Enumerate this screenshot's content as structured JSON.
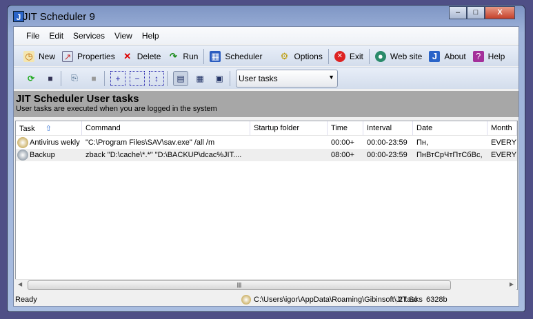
{
  "window": {
    "title": "JIT Scheduler 9",
    "minimize": "–",
    "maximize": "□",
    "close": "X"
  },
  "menu": [
    "File",
    "Edit",
    "Services",
    "View",
    "Help"
  ],
  "toolbar": {
    "new": "New",
    "properties": "Properties",
    "delete": "Delete",
    "run": "Run",
    "scheduler": "Scheduler",
    "options": "Options",
    "exit": "Exit",
    "website": "Web site",
    "about": "About",
    "help": "Help"
  },
  "view_select": {
    "value": "User tasks"
  },
  "panel": {
    "title": "JIT Scheduler User tasks",
    "subtitle": "User tasks are executed when you are logged in the system"
  },
  "columns": [
    "Task",
    "Command",
    "Startup folder",
    "Time",
    "Interval",
    "Date",
    "Month"
  ],
  "rows": [
    {
      "task": "Antivirus wekly",
      "command": "\"C:\\Program Files\\SAV\\sav.exe\" /all /m",
      "folder": "",
      "time": "00:00+",
      "interval": "00:00-23:59",
      "date": "Пн,",
      "month": "EVERY"
    },
    {
      "task": "Backup",
      "command": "zback \"D:\\cache\\*.*\" \"D:\\BACKUP\\dcac%JIT....",
      "folder": "",
      "time": "08:00+",
      "interval": "00:00-23:59",
      "date": "ПнВтСрЧтПтСбВс,",
      "month": "EVERY"
    }
  ],
  "status": {
    "text": "Ready",
    "path": "C:\\Users\\igor\\AppData\\Roaming\\Gibinsoft\\JIT Sc",
    "tasks": "2 tasks",
    "size": "6328b"
  }
}
